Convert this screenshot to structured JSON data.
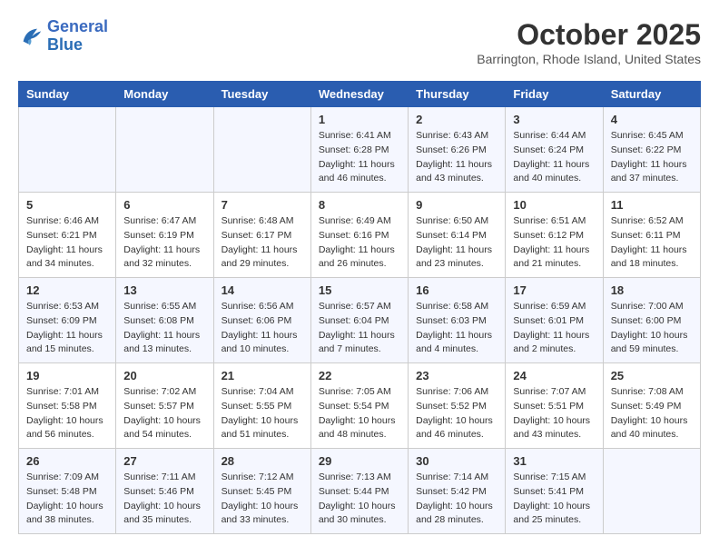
{
  "logo": {
    "line1": "General",
    "line2": "Blue"
  },
  "title": "October 2025",
  "subtitle": "Barrington, Rhode Island, United States",
  "days_of_week": [
    "Sunday",
    "Monday",
    "Tuesday",
    "Wednesday",
    "Thursday",
    "Friday",
    "Saturday"
  ],
  "weeks": [
    [
      {
        "day": "",
        "info": ""
      },
      {
        "day": "",
        "info": ""
      },
      {
        "day": "",
        "info": ""
      },
      {
        "day": "1",
        "info": "Sunrise: 6:41 AM\nSunset: 6:28 PM\nDaylight: 11 hours\nand 46 minutes."
      },
      {
        "day": "2",
        "info": "Sunrise: 6:43 AM\nSunset: 6:26 PM\nDaylight: 11 hours\nand 43 minutes."
      },
      {
        "day": "3",
        "info": "Sunrise: 6:44 AM\nSunset: 6:24 PM\nDaylight: 11 hours\nand 40 minutes."
      },
      {
        "day": "4",
        "info": "Sunrise: 6:45 AM\nSunset: 6:22 PM\nDaylight: 11 hours\nand 37 minutes."
      }
    ],
    [
      {
        "day": "5",
        "info": "Sunrise: 6:46 AM\nSunset: 6:21 PM\nDaylight: 11 hours\nand 34 minutes."
      },
      {
        "day": "6",
        "info": "Sunrise: 6:47 AM\nSunset: 6:19 PM\nDaylight: 11 hours\nand 32 minutes."
      },
      {
        "day": "7",
        "info": "Sunrise: 6:48 AM\nSunset: 6:17 PM\nDaylight: 11 hours\nand 29 minutes."
      },
      {
        "day": "8",
        "info": "Sunrise: 6:49 AM\nSunset: 6:16 PM\nDaylight: 11 hours\nand 26 minutes."
      },
      {
        "day": "9",
        "info": "Sunrise: 6:50 AM\nSunset: 6:14 PM\nDaylight: 11 hours\nand 23 minutes."
      },
      {
        "day": "10",
        "info": "Sunrise: 6:51 AM\nSunset: 6:12 PM\nDaylight: 11 hours\nand 21 minutes."
      },
      {
        "day": "11",
        "info": "Sunrise: 6:52 AM\nSunset: 6:11 PM\nDaylight: 11 hours\nand 18 minutes."
      }
    ],
    [
      {
        "day": "12",
        "info": "Sunrise: 6:53 AM\nSunset: 6:09 PM\nDaylight: 11 hours\nand 15 minutes."
      },
      {
        "day": "13",
        "info": "Sunrise: 6:55 AM\nSunset: 6:08 PM\nDaylight: 11 hours\nand 13 minutes."
      },
      {
        "day": "14",
        "info": "Sunrise: 6:56 AM\nSunset: 6:06 PM\nDaylight: 11 hours\nand 10 minutes."
      },
      {
        "day": "15",
        "info": "Sunrise: 6:57 AM\nSunset: 6:04 PM\nDaylight: 11 hours\nand 7 minutes."
      },
      {
        "day": "16",
        "info": "Sunrise: 6:58 AM\nSunset: 6:03 PM\nDaylight: 11 hours\nand 4 minutes."
      },
      {
        "day": "17",
        "info": "Sunrise: 6:59 AM\nSunset: 6:01 PM\nDaylight: 11 hours\nand 2 minutes."
      },
      {
        "day": "18",
        "info": "Sunrise: 7:00 AM\nSunset: 6:00 PM\nDaylight: 10 hours\nand 59 minutes."
      }
    ],
    [
      {
        "day": "19",
        "info": "Sunrise: 7:01 AM\nSunset: 5:58 PM\nDaylight: 10 hours\nand 56 minutes."
      },
      {
        "day": "20",
        "info": "Sunrise: 7:02 AM\nSunset: 5:57 PM\nDaylight: 10 hours\nand 54 minutes."
      },
      {
        "day": "21",
        "info": "Sunrise: 7:04 AM\nSunset: 5:55 PM\nDaylight: 10 hours\nand 51 minutes."
      },
      {
        "day": "22",
        "info": "Sunrise: 7:05 AM\nSunset: 5:54 PM\nDaylight: 10 hours\nand 48 minutes."
      },
      {
        "day": "23",
        "info": "Sunrise: 7:06 AM\nSunset: 5:52 PM\nDaylight: 10 hours\nand 46 minutes."
      },
      {
        "day": "24",
        "info": "Sunrise: 7:07 AM\nSunset: 5:51 PM\nDaylight: 10 hours\nand 43 minutes."
      },
      {
        "day": "25",
        "info": "Sunrise: 7:08 AM\nSunset: 5:49 PM\nDaylight: 10 hours\nand 40 minutes."
      }
    ],
    [
      {
        "day": "26",
        "info": "Sunrise: 7:09 AM\nSunset: 5:48 PM\nDaylight: 10 hours\nand 38 minutes."
      },
      {
        "day": "27",
        "info": "Sunrise: 7:11 AM\nSunset: 5:46 PM\nDaylight: 10 hours\nand 35 minutes."
      },
      {
        "day": "28",
        "info": "Sunrise: 7:12 AM\nSunset: 5:45 PM\nDaylight: 10 hours\nand 33 minutes."
      },
      {
        "day": "29",
        "info": "Sunrise: 7:13 AM\nSunset: 5:44 PM\nDaylight: 10 hours\nand 30 minutes."
      },
      {
        "day": "30",
        "info": "Sunrise: 7:14 AM\nSunset: 5:42 PM\nDaylight: 10 hours\nand 28 minutes."
      },
      {
        "day": "31",
        "info": "Sunrise: 7:15 AM\nSunset: 5:41 PM\nDaylight: 10 hours\nand 25 minutes."
      },
      {
        "day": "",
        "info": ""
      }
    ]
  ]
}
